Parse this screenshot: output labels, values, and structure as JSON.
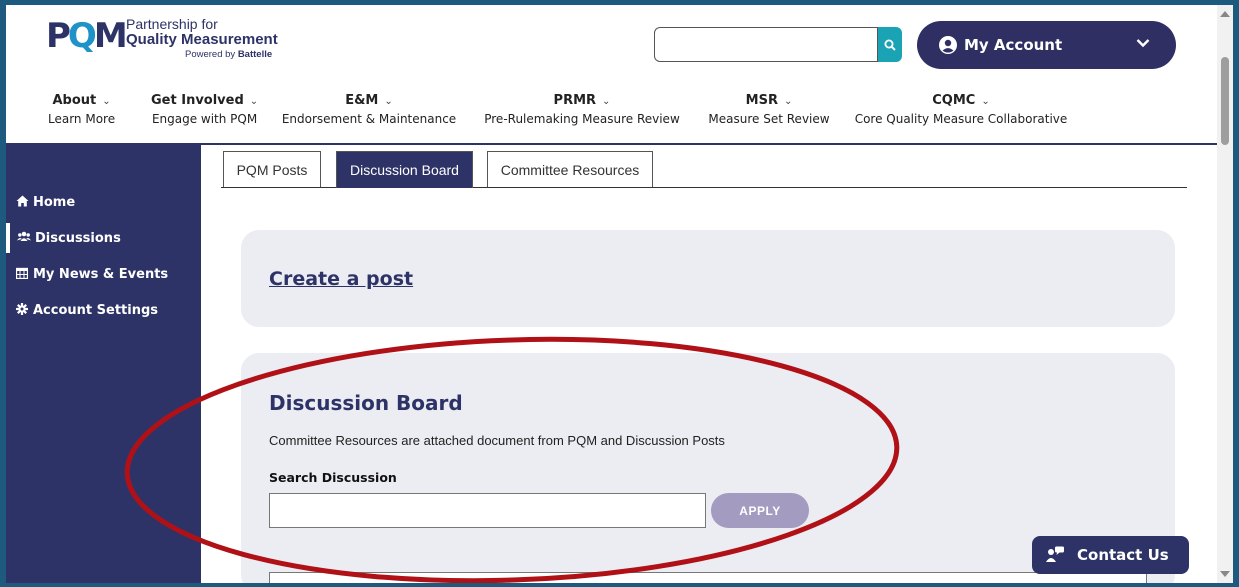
{
  "logo": {
    "mark": "PQM",
    "line1": "Partnership for",
    "line2": "Quality Measurement",
    "line3_prefix": "Powered by ",
    "line3_brand": "Battelle"
  },
  "header": {
    "search_placeholder": "",
    "account_label": "My Account"
  },
  "nav": [
    {
      "title": "About",
      "sub": "Learn More"
    },
    {
      "title": "Get Involved",
      "sub": "Engage with PQM"
    },
    {
      "title": "E&M",
      "sub": "Endorsement & Maintenance"
    },
    {
      "title": "PRMR",
      "sub": "Pre-Rulemaking Measure Review"
    },
    {
      "title": "MSR",
      "sub": "Measure Set Review"
    },
    {
      "title": "CQMC",
      "sub": "Core Quality Measure Collaborative"
    }
  ],
  "sidebar": {
    "items": [
      {
        "label": "Home",
        "icon": "home-icon"
      },
      {
        "label": "Discussions",
        "icon": "users-icon"
      },
      {
        "label": "My News & Events",
        "icon": "calendar-icon"
      },
      {
        "label": "Account Settings",
        "icon": "gear-icon"
      }
    ],
    "active_index": 1
  },
  "tabs": [
    {
      "label": "PQM Posts"
    },
    {
      "label": "Discussion Board"
    },
    {
      "label": "Committee Resources"
    }
  ],
  "active_tab": 1,
  "create_post": {
    "label": "Create a post"
  },
  "board": {
    "title": "Discussion Board",
    "description": "Committee Resources are attached document from PQM and Discussion Posts",
    "search_label": "Search Discussion",
    "search_value": "",
    "apply_label": "APPLY"
  },
  "contact": {
    "label": "Contact Us"
  },
  "colors": {
    "brand_navy": "#2e3367",
    "search_teal": "#1aa3b5",
    "apply_purple": "#a49bc0",
    "annotation_red": "#b01116"
  }
}
